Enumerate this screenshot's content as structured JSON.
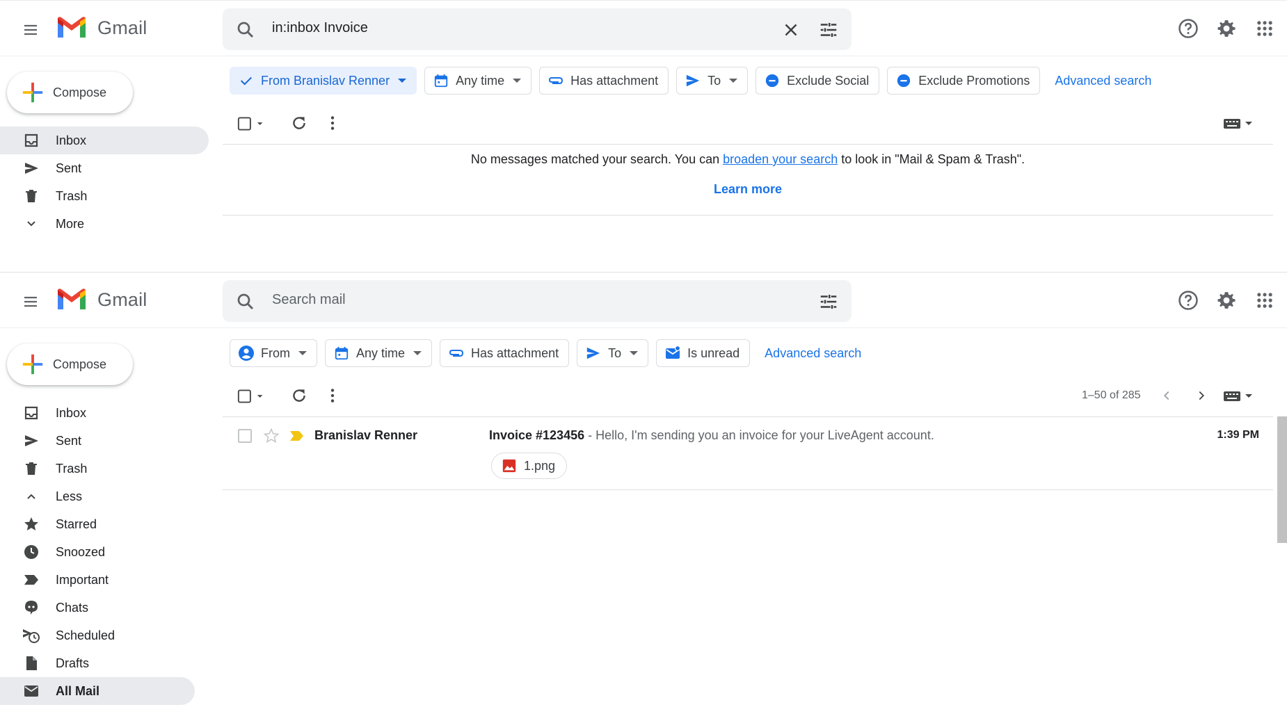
{
  "brand": {
    "name": "Gmail"
  },
  "compose_label": "Compose",
  "colors": {
    "accent": "#1a73e8",
    "chip_active_bg": "#e8f0fe",
    "important": "#f2c511",
    "attachment_red": "#d93025"
  },
  "paneA": {
    "search": {
      "value": "in:inbox Invoice",
      "placeholder": "Search mail"
    },
    "nav": [
      {
        "label": "Inbox",
        "icon": "inbox-icon",
        "active": true
      },
      {
        "label": "Sent",
        "icon": "send-icon"
      },
      {
        "label": "Trash",
        "icon": "trash-icon"
      },
      {
        "label": "More",
        "icon": "chevron-down-icon"
      }
    ],
    "chips": {
      "from": "From Branislav Renner",
      "anytime": "Any time",
      "attachment": "Has attachment",
      "to": "To",
      "exclude_social": "Exclude Social",
      "exclude_promotions": "Exclude Promotions"
    },
    "advanced_search": "Advanced search",
    "empty_message": {
      "before": "No messages matched your search. You can ",
      "link": "broaden your search",
      "after": " to look in \"Mail & Spam & Trash\"."
    },
    "learn_more": "Learn more"
  },
  "paneB": {
    "search": {
      "placeholder": "Search mail"
    },
    "nav": [
      {
        "label": "Inbox",
        "icon": "inbox-icon"
      },
      {
        "label": "Sent",
        "icon": "send-icon"
      },
      {
        "label": "Trash",
        "icon": "trash-icon"
      },
      {
        "label": "Less",
        "icon": "chevron-up-icon"
      },
      {
        "label": "Starred",
        "icon": "star-icon"
      },
      {
        "label": "Snoozed",
        "icon": "clock-icon"
      },
      {
        "label": "Important",
        "icon": "important-icon"
      },
      {
        "label": "Chats",
        "icon": "chat-icon"
      },
      {
        "label": "Scheduled",
        "icon": "scheduled-icon"
      },
      {
        "label": "Drafts",
        "icon": "draft-icon"
      },
      {
        "label": "All Mail",
        "icon": "mail-icon",
        "active": true
      }
    ],
    "chips": {
      "from": "From",
      "anytime": "Any time",
      "attachment": "Has attachment",
      "to": "To",
      "unread": "Is unread"
    },
    "advanced_search": "Advanced search",
    "pagination": "1–50 of 285",
    "messages": [
      {
        "sender": "Branislav Renner",
        "subject": "Invoice #123456",
        "snippet": " - Hello, I'm sending you an invoice for your LiveAgent account.",
        "time": "1:39 PM",
        "attachment": "1.png"
      }
    ]
  }
}
